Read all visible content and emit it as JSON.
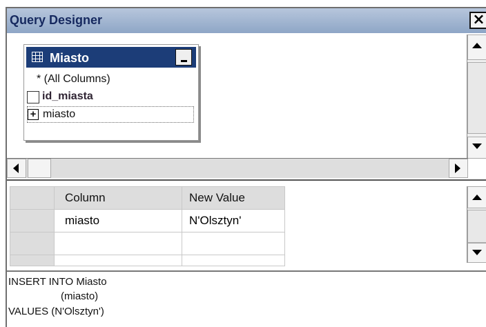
{
  "window": {
    "title": "Query Designer",
    "close_glyph": "×"
  },
  "diagram": {
    "table": {
      "name": "Miasto",
      "icon": "table-icon",
      "columns": [
        {
          "label": "* (All Columns)",
          "kind": "all"
        },
        {
          "label": "id_miasta",
          "kind": "key"
        },
        {
          "label": "miasto",
          "kind": "selected",
          "marker": "+"
        }
      ]
    }
  },
  "grid": {
    "headers": [
      "Column",
      "New Value"
    ],
    "rows": [
      [
        "miasto",
        "N'Olsztyn'"
      ],
      [
        "",
        ""
      ],
      [
        "",
        ""
      ]
    ]
  },
  "sql": {
    "lines": [
      "INSERT INTO Miasto",
      "(miasto)",
      "VALUES (N'Olsztyn')"
    ]
  },
  "colors": {
    "title_text": "#16295f",
    "table_header": "#1c3d78",
    "grid_header": "#dddddd"
  }
}
